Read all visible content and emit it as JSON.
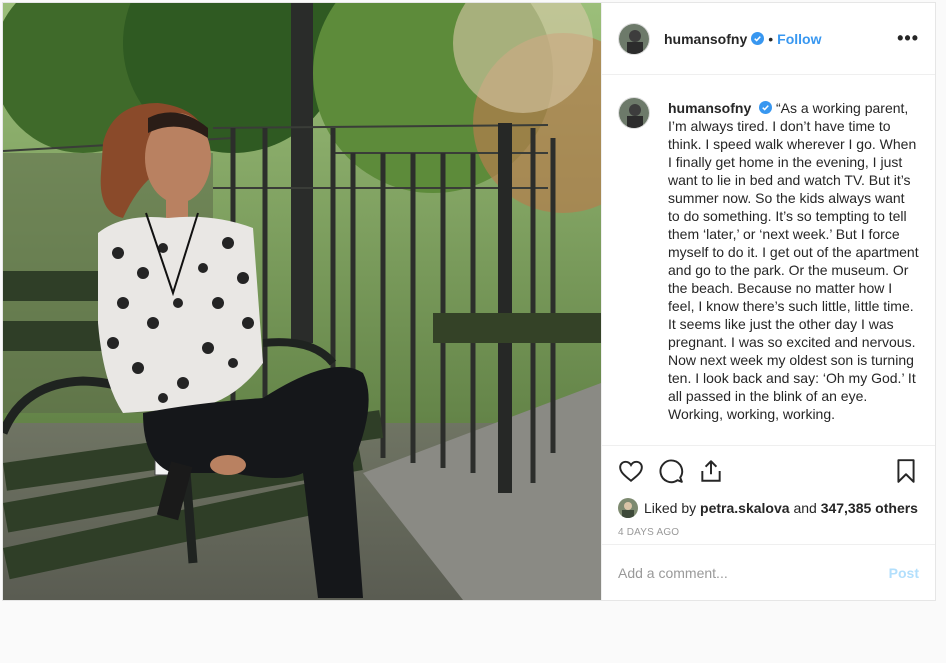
{
  "post": {
    "username": "humansofny",
    "separator": "•",
    "follow_label": "Follow",
    "more_label": "•••",
    "caption": "“As a working parent, I’m always tired. I don’t have time to think. I speed walk wherever I go. When I finally get home in the evening, I just want to lie in bed and watch TV. But it’s summer now. So the kids always want to do something. It’s so tempting to tell them ‘later,’ or ‘next week.’ But I force myself to do it. I get out of the apartment and go to the park. Or the museum. Or the beach. Because no matter how I feel, I know there’s such little, little time. It seems like just the other day I was pregnant. I was so excited and nervous. Now next week my oldest son is turning ten. I look back and say: ‘Oh my God.’ It all passed in the blink of an eye. Working, working, working.",
    "liked_by_prefix": "Liked by",
    "liked_by_user": "petra.skalova",
    "liked_by_middle": "and",
    "liked_by_count": "347,385 others",
    "time_ago": "4 DAYS AGO",
    "comment_placeholder": "Add a comment...",
    "post_label": "Post"
  },
  "icons": {
    "verified": "verified-badge-icon",
    "like": "heart-icon",
    "comment": "comment-bubble-icon",
    "share": "share-icon",
    "save": "bookmark-icon",
    "more": "more-options-icon"
  },
  "colors": {
    "accent": "#3897f0",
    "post_disabled": "#b2dffc",
    "muted": "#999999",
    "text": "#262626"
  }
}
